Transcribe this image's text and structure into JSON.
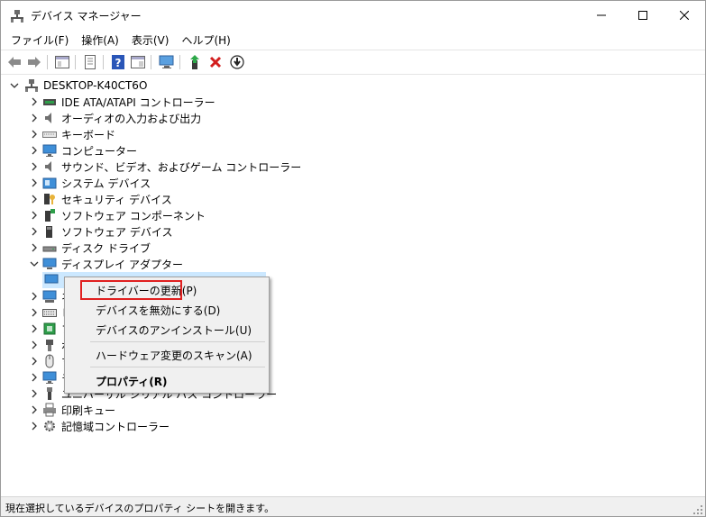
{
  "window": {
    "title": "デバイス マネージャー"
  },
  "menu": [
    "ファイル(F)",
    "操作(A)",
    "表示(V)",
    "ヘルプ(H)"
  ],
  "toolbar_icons": [
    "back-arrow-icon",
    "forward-arrow-icon",
    "tree-view-icon",
    "properties-icon",
    "help-icon",
    "console-icon",
    "monitor-scan-icon",
    "update-driver-icon",
    "uninstall-x-icon",
    "disable-down-icon"
  ],
  "tree": {
    "root": "DESKTOP-K40CT6O",
    "items": [
      "IDE ATA/ATAPI コントローラー",
      "オーディオの入力および出力",
      "キーボード",
      "コンピューター",
      "サウンド、ビデオ、およびゲーム コントローラー",
      "システム デバイス",
      "セキュリティ デバイス",
      "ソフトウェア コンポーネント",
      "ソフトウェア デバイス",
      "ディスク ドライブ",
      "ディスプレイ アダプター",
      "ネ",
      "ヒ",
      "フ",
      "ポ",
      "マ",
      "モ",
      "ユニバーサル シリアル バス コントローラー",
      "印刷キュー",
      "記憶域コントローラー"
    ]
  },
  "context_menu": {
    "update_driver": "ドライバーの更新(P)",
    "disable": "デバイスを無効にする(D)",
    "uninstall": "デバイスのアンインストール(U)",
    "scan": "ハードウェア変更のスキャン(A)",
    "properties": "プロパティ(R)"
  },
  "status": "現在選択しているデバイスのプロパティ シートを開きます。",
  "colors": {
    "highlight_border": "#e02020",
    "menu_bg": "#f0f0f0",
    "accent": "#1e6fc8"
  }
}
